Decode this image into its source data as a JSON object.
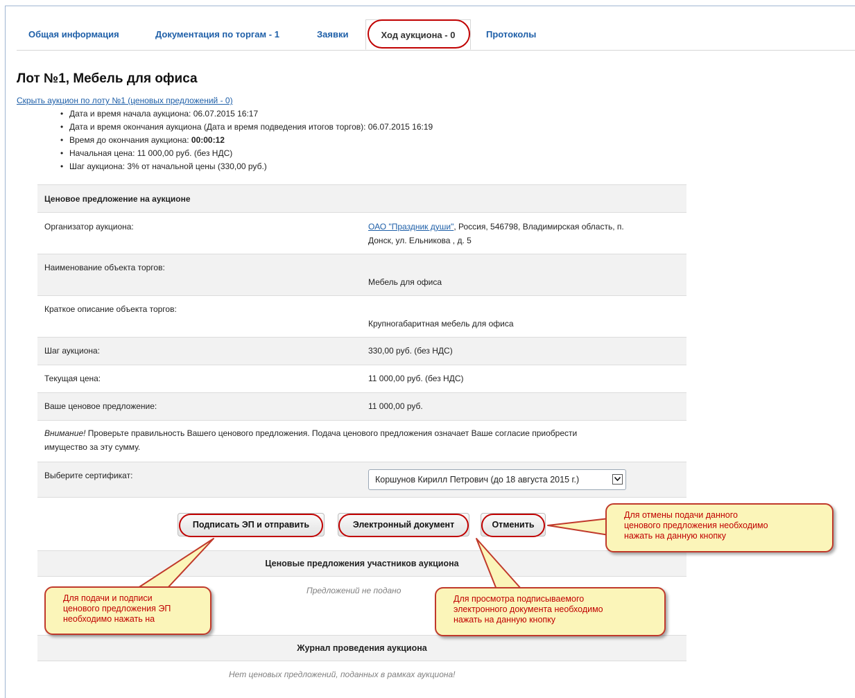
{
  "tabs": [
    {
      "label": "Общая информация"
    },
    {
      "label": "Документация по торгам - 1"
    },
    {
      "label": "Заявки"
    },
    {
      "label": "Ход аукциона - 0"
    },
    {
      "label": "Протоколы"
    }
  ],
  "lot_title": "Лот №1, Мебель для офиса",
  "hide_link": "Скрыть аукцион по лоту №1 (ценовых предложений - 0)",
  "info": {
    "start": "Дата и время начала аукциона: 06.07.2015 16:17",
    "end": "Дата и время окончания аукциона (Дата и время подведения итогов торгов): 06.07.2015 16:19",
    "time_left_label": "Время до окончания аукциона: ",
    "time_left_value": "00:00:12",
    "start_price": "Начальная цена: 11 000,00 руб. (без НДС)",
    "step": "Шаг аукциона: 3% от начальной цены (330,00 руб.)"
  },
  "table": {
    "header": "Ценовое предложение на аукционе",
    "organizer_label": "Организатор аукциона:",
    "organizer_link": "ОАО \"Праздник души\"",
    "organizer_rest_1": ", Россия, 546798, Владимирская область, п.",
    "organizer_rest_2": "Донск, ул. Ельникова , д. 5",
    "object_name_label": "Наименование объекта торгов:",
    "object_name_value": "Мебель для офиса",
    "object_desc_label": "Краткое описание объекта торгов:",
    "object_desc_value": "Крупногабаритная мебель для офиса",
    "step_label": "Шаг аукциона:",
    "step_value": "330,00 руб. (без НДС)",
    "current_price_label": "Текущая цена:",
    "current_price_value": "11 000,00 руб. (без НДС)",
    "your_bid_label": "Ваше ценовое предложение:",
    "your_bid_value": "11 000,00 руб.",
    "warning_em": "Внимание!",
    "warning_text_1": " Проверьте правильность Вашего ценового предложения. Подача ценового предложения означает Ваше согласие приобрести",
    "warning_text_2": "имущество за эту сумму.",
    "cert_label": "Выберите сертификат:",
    "cert_value": "Коршунов Кирилл Петрович (до 18 августа 2015 г.)"
  },
  "buttons": {
    "sign": "Подписать ЭП и отправить",
    "edoc": "Электронный документ",
    "cancel": "Отменить"
  },
  "bids_section": {
    "title": "Ценовые предложения участников аукциона",
    "empty": "Предложений не подано"
  },
  "log_section": {
    "title": "Журнал проведения аукциона",
    "empty": "Нет ценовых предложений, поданных в рамках аукциона!"
  },
  "callouts": {
    "cancel_1": "Для отмены подачи данного",
    "cancel_2": "ценового предложения необходимо",
    "cancel_3": "нажать на данную кнопку",
    "sign_1": "Для подачи и подписи",
    "sign_2": "ценового предложения ЭП",
    "sign_3": "необходимо нажать на",
    "edoc_1": "Для просмотра подписываемого",
    "edoc_2": "электронного документа необходимо",
    "edoc_3": "нажать на данную кнопку"
  },
  "colors": {
    "link": "#1e5fa8",
    "highlight_ring": "#c00000",
    "callout_bg": "#fbf5b9"
  }
}
